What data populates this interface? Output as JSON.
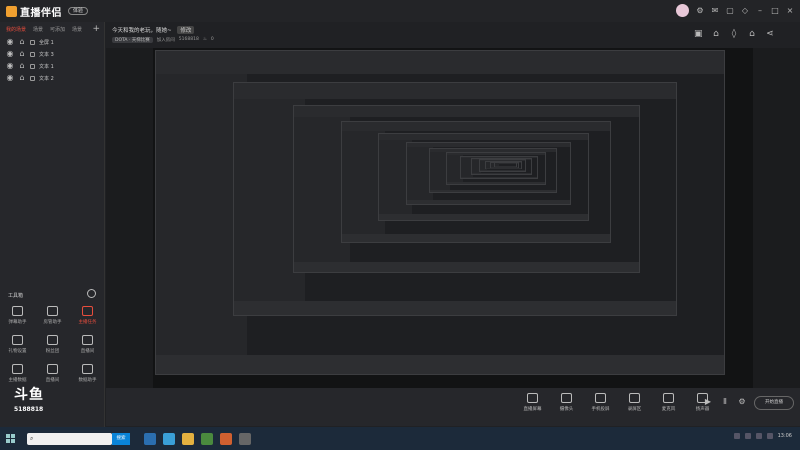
{
  "app": {
    "name": "直播伴侣",
    "badge": "体验"
  },
  "scene_tabs": [
    "我的场景",
    "场景",
    "可添加",
    "场景"
  ],
  "scene_add": "+",
  "sources": [
    {
      "label": "全屏 1"
    },
    {
      "label": "文本 3"
    },
    {
      "label": "文本 1"
    },
    {
      "label": "文本 2"
    }
  ],
  "toolbox": {
    "title": "工具箱",
    "items": [
      {
        "label": "弹幕助手",
        "hot": false
      },
      {
        "label": "房管助手",
        "hot": false
      },
      {
        "label": "主播任务",
        "hot": true
      },
      {
        "label": "礼物设置",
        "hot": false
      },
      {
        "label": "粉丝团",
        "hot": false
      },
      {
        "label": "直播间",
        "hot": false
      },
      {
        "label": "主播数据",
        "hot": false
      },
      {
        "label": "直播间",
        "hot": false
      },
      {
        "label": "数据助手",
        "hot": false
      }
    ]
  },
  "watermark": {
    "logo": "斗鱼",
    "room": "5188818"
  },
  "stream": {
    "title": "今天和我的老玩，随她~",
    "edit": "修改",
    "category": "DOTA · 天梯比赛",
    "viewers": "加入房间",
    "room_id": "5168818",
    "hot": "0"
  },
  "bottom_actions": [
    {
      "label": "直播屏幕"
    },
    {
      "label": "摄像头"
    },
    {
      "label": "手机投屏"
    },
    {
      "label": "录屏区"
    },
    {
      "label": "麦克风"
    },
    {
      "label": "扬声器"
    }
  ],
  "start_button": "开始直播",
  "taskbar": {
    "search_placeholder": "",
    "search_button": "搜索",
    "time": "13:06"
  }
}
